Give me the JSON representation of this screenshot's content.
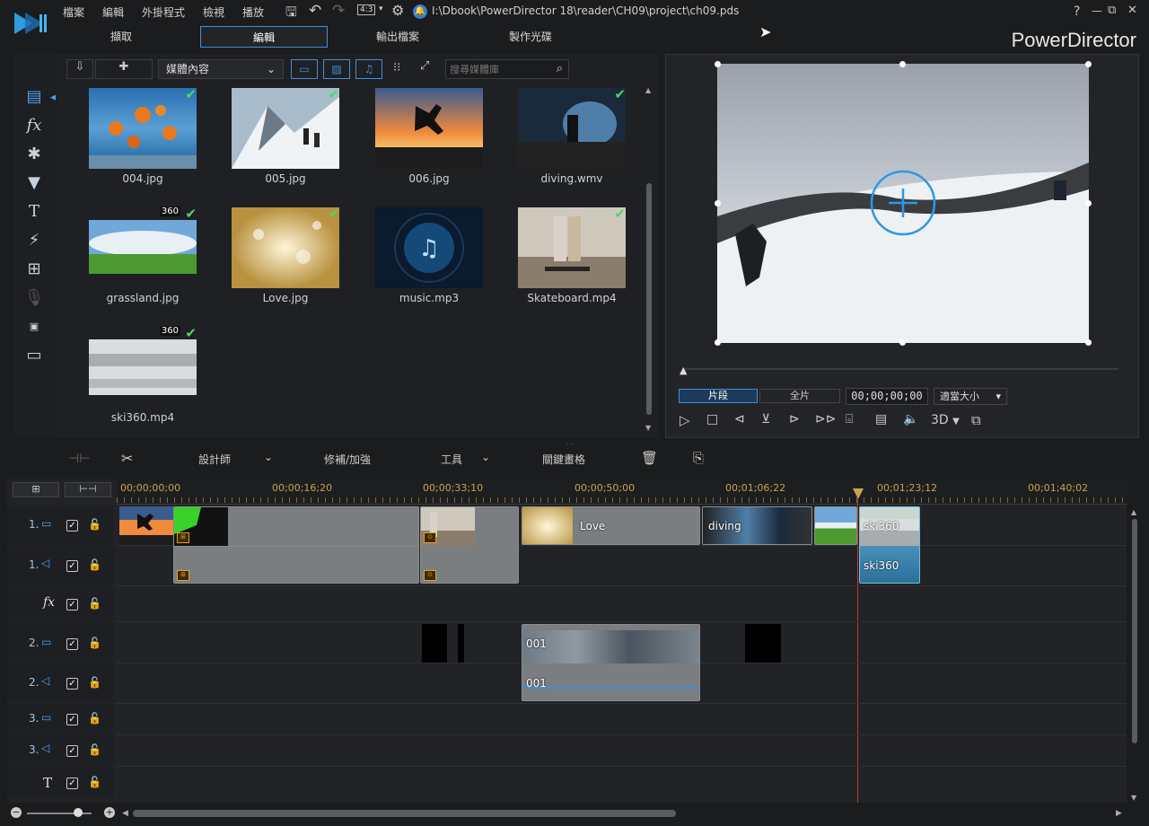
{
  "menu": {
    "file": "檔案",
    "edit": "編輯",
    "plugins": "外掛程式",
    "view": "檢視",
    "play": "播放",
    "aspect": "4:3",
    "path": "I:\\Dbook\\PowerDirector 18\\reader\\CH09\\project\\ch09.pds"
  },
  "window": {
    "help": "?",
    "minimize": "—",
    "restore": "⧉",
    "close": "✕"
  },
  "tabs": {
    "capture": "擷取",
    "edit": "編輯",
    "produce": "輸出檔案",
    "disc": "製作光碟"
  },
  "brand": "PowerDirector",
  "library": {
    "filter": "媒體內容",
    "search_placeholder": "搜尋媒體庫",
    "items": [
      {
        "name": "004.jpg",
        "checked": true
      },
      {
        "name": "005.jpg",
        "checked": true
      },
      {
        "name": "006.jpg",
        "checked": false
      },
      {
        "name": "diving.wmv",
        "checked": true
      },
      {
        "name": "grassland.jpg",
        "checked": true,
        "badge": "360"
      },
      {
        "name": "Love.jpg",
        "checked": true
      },
      {
        "name": "music.mp3",
        "checked": false
      },
      {
        "name": "Skateboard.mp4",
        "checked": true
      },
      {
        "name": "ski360.mp4",
        "checked": true,
        "badge": "360"
      }
    ]
  },
  "preview": {
    "clip_mode": "片段",
    "movie_mode": "全片",
    "timecode": "00;00;00;00",
    "zoom": "適當大小",
    "stereo": "3D"
  },
  "toolbar": {
    "designer": "設計師",
    "fix": "修補/加強",
    "tools": "工具",
    "keyframe": "關鍵畫格"
  },
  "ruler": [
    "00;00;00;00",
    "00;00;16;20",
    "00;00;33;10",
    "00;00;50;00",
    "00;01;06;22",
    "00;01;23;12",
    "00;01;40;02"
  ],
  "tracks": [
    {
      "id": "1.",
      "kind": "video"
    },
    {
      "id": "1.",
      "kind": "audio"
    },
    {
      "id": "fx",
      "kind": "fx"
    },
    {
      "id": "2.",
      "kind": "video"
    },
    {
      "id": "2.",
      "kind": "audio"
    },
    {
      "id": "3.",
      "kind": "video"
    },
    {
      "id": "3.",
      "kind": "audio"
    },
    {
      "id": "T",
      "kind": "title"
    }
  ],
  "clips": {
    "love": "Love",
    "diving": "diving",
    "ski_video": "ski360",
    "ski_audio": "ski360",
    "c001_video": "001",
    "c001_audio": "001"
  },
  "colors": {
    "accent": "#3f8fd9",
    "check": "#4cd964",
    "playhead": "#c0392b",
    "ruler": "#c9a24a"
  }
}
